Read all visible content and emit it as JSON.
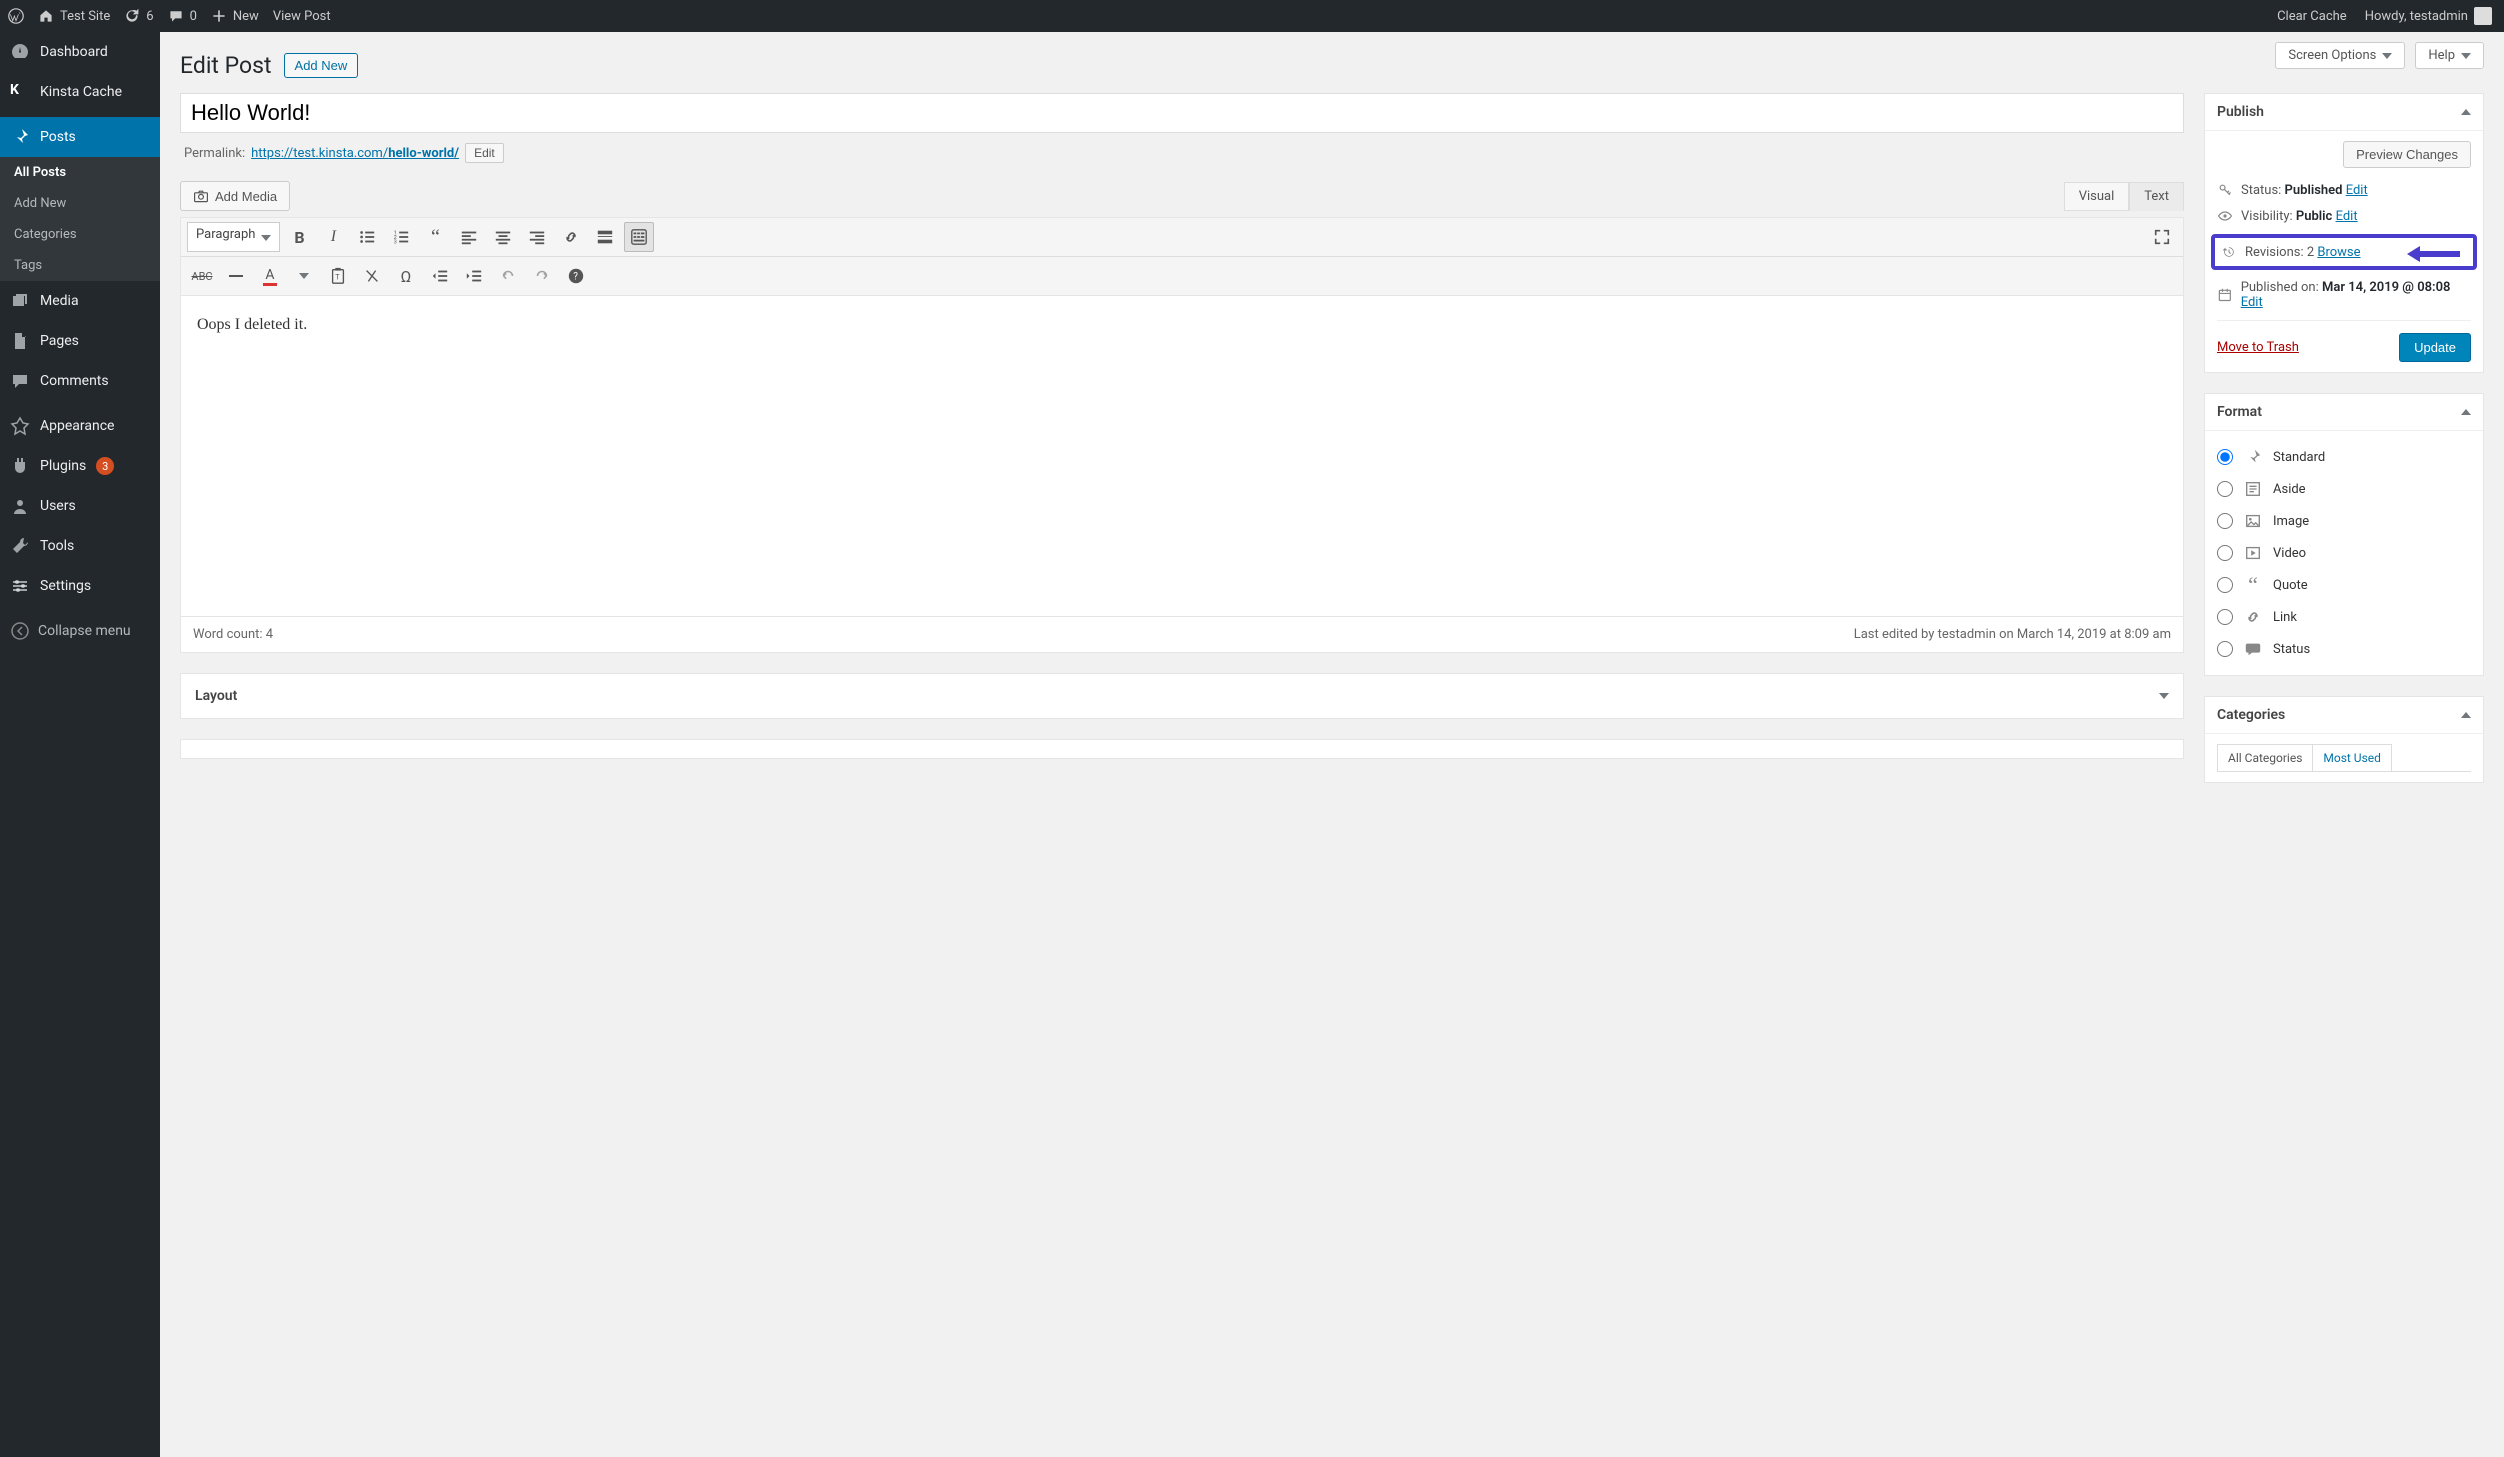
{
  "adminbar": {
    "site_name": "Test Site",
    "updates_count": "6",
    "comments_count": "0",
    "new_label": "New",
    "view_post": "View Post",
    "clear_cache": "Clear Cache",
    "howdy_prefix": "Howdy, ",
    "username": "testadmin"
  },
  "sidebar": {
    "dashboard": "Dashboard",
    "kinsta_cache": "Kinsta Cache",
    "posts": "Posts",
    "submenu": {
      "all_posts": "All Posts",
      "add_new": "Add New",
      "categories": "Categories",
      "tags": "Tags"
    },
    "media": "Media",
    "pages": "Pages",
    "comments": "Comments",
    "appearance": "Appearance",
    "plugins": "Plugins",
    "plugins_badge": "3",
    "users": "Users",
    "tools": "Tools",
    "settings": "Settings",
    "collapse": "Collapse menu"
  },
  "topbuttons": {
    "screen_options": "Screen Options",
    "help": "Help"
  },
  "page": {
    "heading": "Edit Post",
    "add_new": "Add New",
    "title_value": "Hello World!",
    "permalink_label": "Permalink: ",
    "permalink_base": "https://test.kinsta.com/",
    "permalink_slug": "hello-world/",
    "permalink_edit": "Edit"
  },
  "editor": {
    "add_media": "Add Media",
    "tabs": {
      "visual": "Visual",
      "text": "Text"
    },
    "format_select": "Paragraph",
    "body_text": "Oops I deleted it.",
    "footer_wordcount": "Word count: 4",
    "footer_lastedit": "Last edited by testadmin on March 14, 2019 at 8:09 am"
  },
  "publish": {
    "box_title": "Publish",
    "preview": "Preview Changes",
    "status_label": "Status: ",
    "status_value": "Published",
    "visibility_label": "Visibility: ",
    "visibility_value": "Public",
    "revisions_label": "Revisions: ",
    "revisions_count": "2",
    "revisions_browse": "Browse",
    "published_label": "Published on: ",
    "published_value": "Mar 14, 2019 @ 08:08",
    "edit": "Edit",
    "trash": "Move to Trash",
    "update": "Update"
  },
  "format": {
    "box_title": "Format",
    "items": [
      "Standard",
      "Aside",
      "Image",
      "Video",
      "Quote",
      "Link",
      "Status"
    ]
  },
  "categories": {
    "box_title": "Categories",
    "tab_all": "All Categories",
    "tab_most": "Most Used"
  },
  "layout_box": {
    "title": "Layout"
  }
}
